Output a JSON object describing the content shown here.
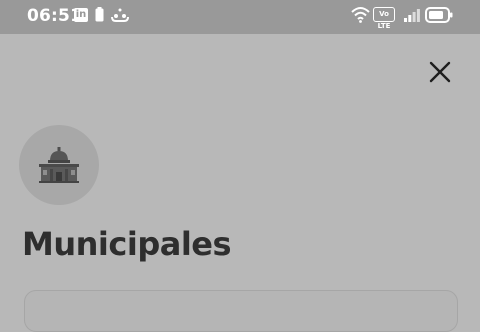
{
  "status_bar": {
    "time": "06:51",
    "linkedin_glyph": "in",
    "volte_label": "Vo LTE",
    "left_icons": [
      "linkedin-icon",
      "battery-small-icon",
      "message-icon"
    ],
    "right_icons": [
      "wifi-icon",
      "volte-icon",
      "signal-icon",
      "battery-icon"
    ]
  },
  "header": {
    "close_icon": "close-icon"
  },
  "page": {
    "logo_icon": "municipal-building-icon",
    "title": "Municipales"
  },
  "colors": {
    "overlay_bg": "#b8b8b8",
    "status_bar_bg": "#999999",
    "title_text": "#2e2e2e",
    "logo_circle_bg": "#a8a8a8"
  }
}
